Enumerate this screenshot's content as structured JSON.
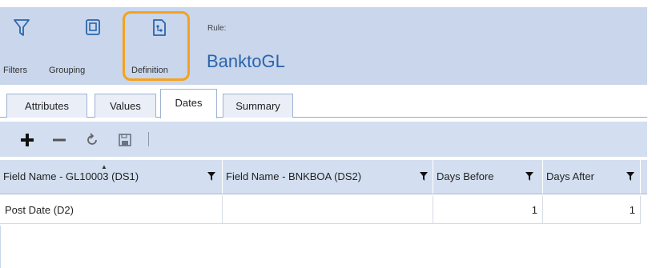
{
  "ribbon": {
    "filters_label": "Filters",
    "grouping_label": "Grouping",
    "definition_label": "Definition",
    "rule_caption": "Rule:",
    "rule_name": "BanktoGL",
    "highlight_color": "#f6a21b"
  },
  "tabs": [
    {
      "label": "Attributes",
      "active": false
    },
    {
      "label": "Values",
      "active": false
    },
    {
      "label": "Dates",
      "active": true
    },
    {
      "label": "Summary",
      "active": false
    }
  ],
  "toolbar": {
    "icons": [
      "plus-icon",
      "minus-icon",
      "refresh-icon",
      "save-icon"
    ]
  },
  "grid": {
    "columns": [
      {
        "label": "Field Name - GL10003 (DS1)",
        "sorted": "ascending",
        "filter_icon": "filter-icon"
      },
      {
        "label": "Field Name - BNKBOA (DS2)",
        "filter_icon": "filter-icon"
      },
      {
        "label": "Days Before",
        "filter_icon": "filter-icon"
      },
      {
        "label": "Days After",
        "filter_icon": "filter-icon"
      }
    ],
    "rows": [
      [
        "Post Date (D2)",
        "",
        "1",
        "1"
      ]
    ]
  }
}
